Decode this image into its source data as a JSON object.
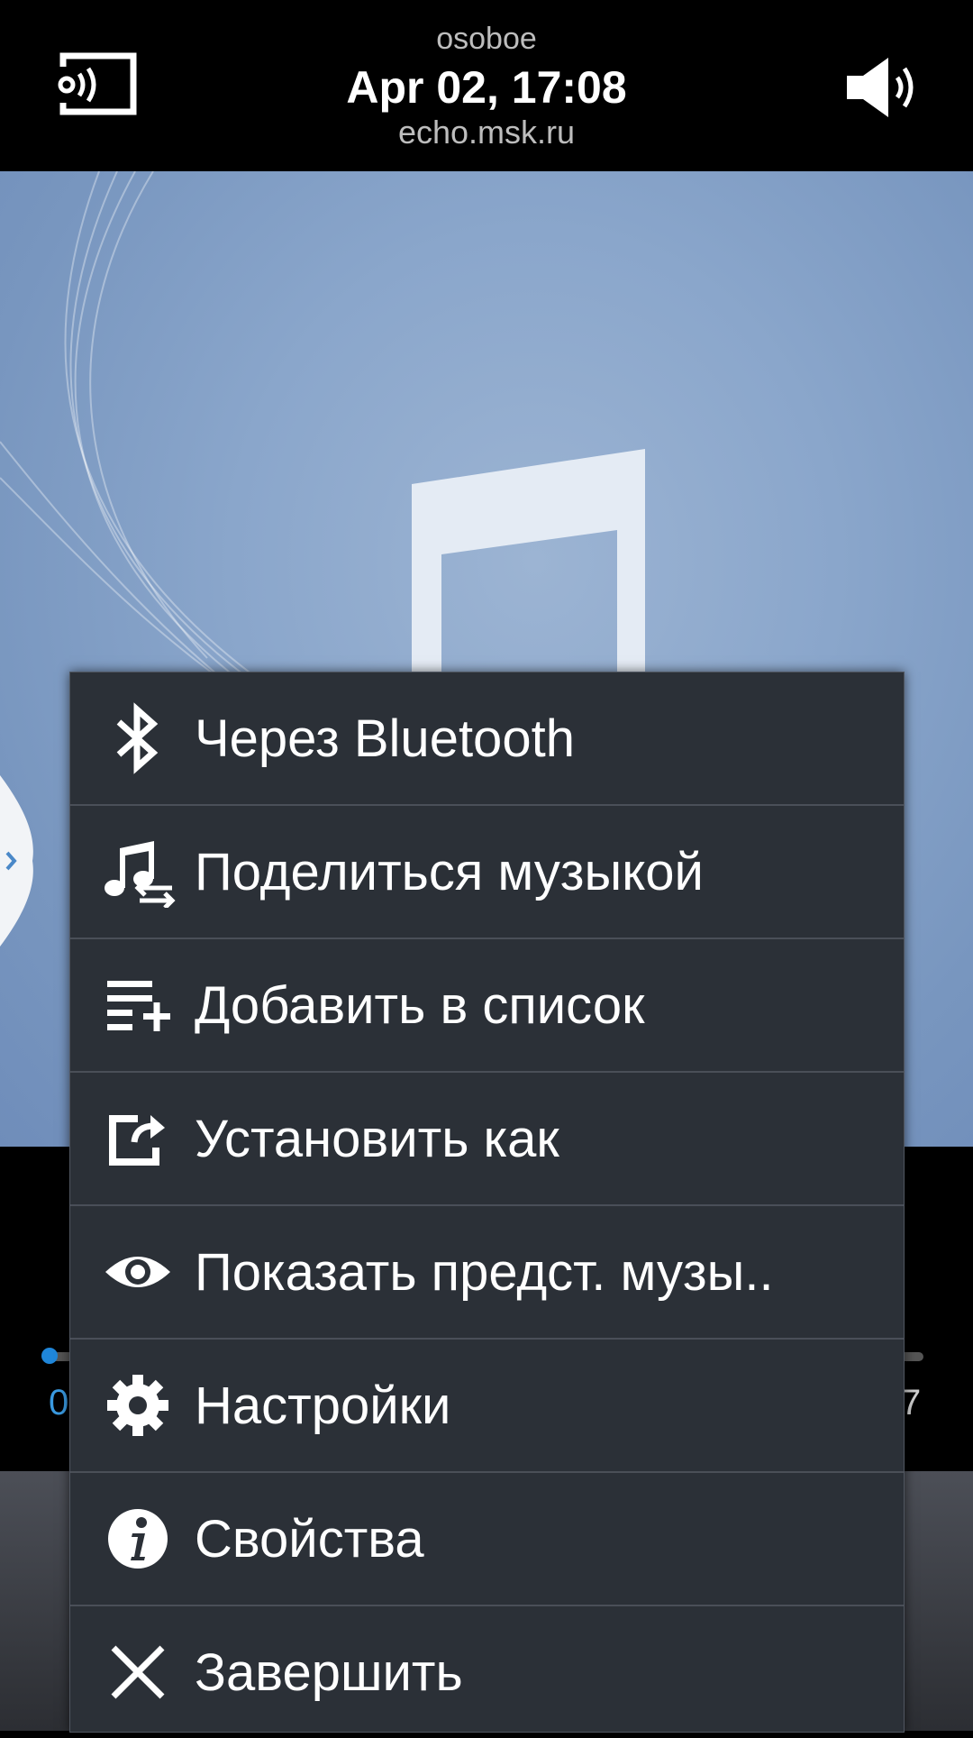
{
  "header": {
    "title": "osoboe",
    "datetime": "Apr 02, 17:08",
    "source": "echo.msk.ru"
  },
  "player": {
    "elapsed_partial": "0",
    "total_partial": "7",
    "progress": 0.0
  },
  "menu": {
    "items": [
      {
        "label": "Через Bluetooth",
        "icon": "bluetooth-icon"
      },
      {
        "label": "Поделиться музыкой",
        "icon": "share-music-icon"
      },
      {
        "label": "Добавить в список",
        "icon": "add-to-playlist-icon"
      },
      {
        "label": "Установить как",
        "icon": "set-as-icon"
      },
      {
        "label": "Показать предст. музы..",
        "icon": "eye-icon"
      },
      {
        "label": "Настройки",
        "icon": "gear-icon"
      },
      {
        "label": "Свойства",
        "icon": "info-icon"
      },
      {
        "label": "Завершить",
        "icon": "close-icon"
      }
    ]
  },
  "colors": {
    "menu_bg": "#2b3037",
    "accent": "#1f86d9",
    "art_bg": "#8aa6cb"
  }
}
